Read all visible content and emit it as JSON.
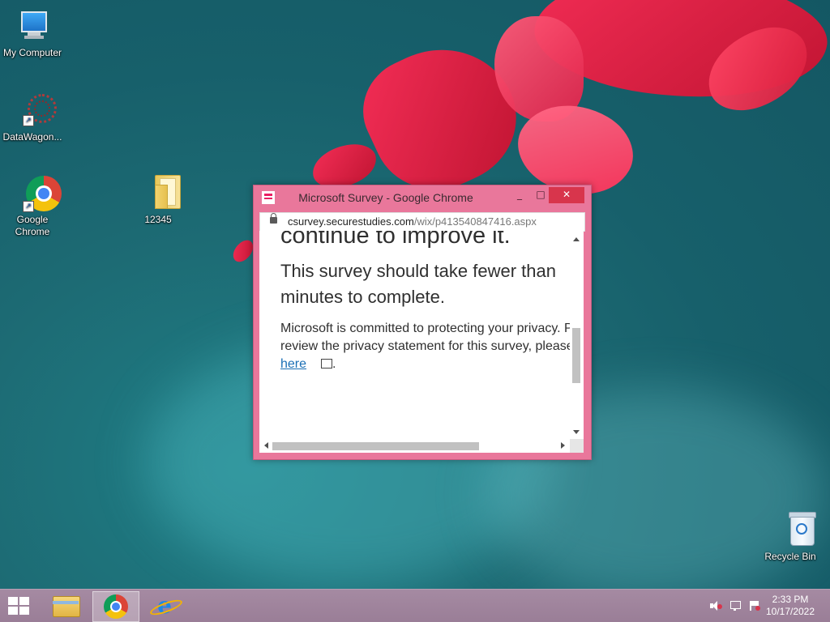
{
  "desktop": {
    "icons": [
      {
        "label": "My Computer",
        "icon": "monitor-icon"
      },
      {
        "label": "DataWagon...",
        "icon": "datawagon-icon"
      },
      {
        "label": "Google Chrome",
        "icon": "chrome-icon"
      },
      {
        "label": "12345",
        "icon": "folder-icon"
      },
      {
        "label": "Recycle Bin",
        "icon": "recycle-bin-icon"
      }
    ]
  },
  "window": {
    "title": "Microsoft Survey - Google Chrome",
    "minimize": "_",
    "maximize": "□",
    "close": "✕",
    "url_host": "csurvey.securestudies.com",
    "url_path": "/wix/p413540847416.aspx",
    "content": {
      "heading_cut": "continue to improve it.",
      "subheading": "This survey should take fewer than minutes to complete.",
      "paragraph": "Microsoft is committed to protecting your privacy. Please review the privacy statement for this survey, please click",
      "link": "here",
      "period": "."
    }
  },
  "taskbar": {
    "apps": [
      {
        "name": "File Explorer",
        "icon": "file-explorer-icon"
      },
      {
        "name": "Google Chrome",
        "icon": "chrome-icon",
        "active": true
      },
      {
        "name": "Internet Explorer",
        "icon": "ie-icon"
      }
    ],
    "time": "2:33 PM",
    "date": "10/17/2022"
  },
  "colors": {
    "window_frame": "#e9779b",
    "close_button": "#d8354c",
    "taskbar": "#a58aa2",
    "link": "#1a6fb5"
  }
}
